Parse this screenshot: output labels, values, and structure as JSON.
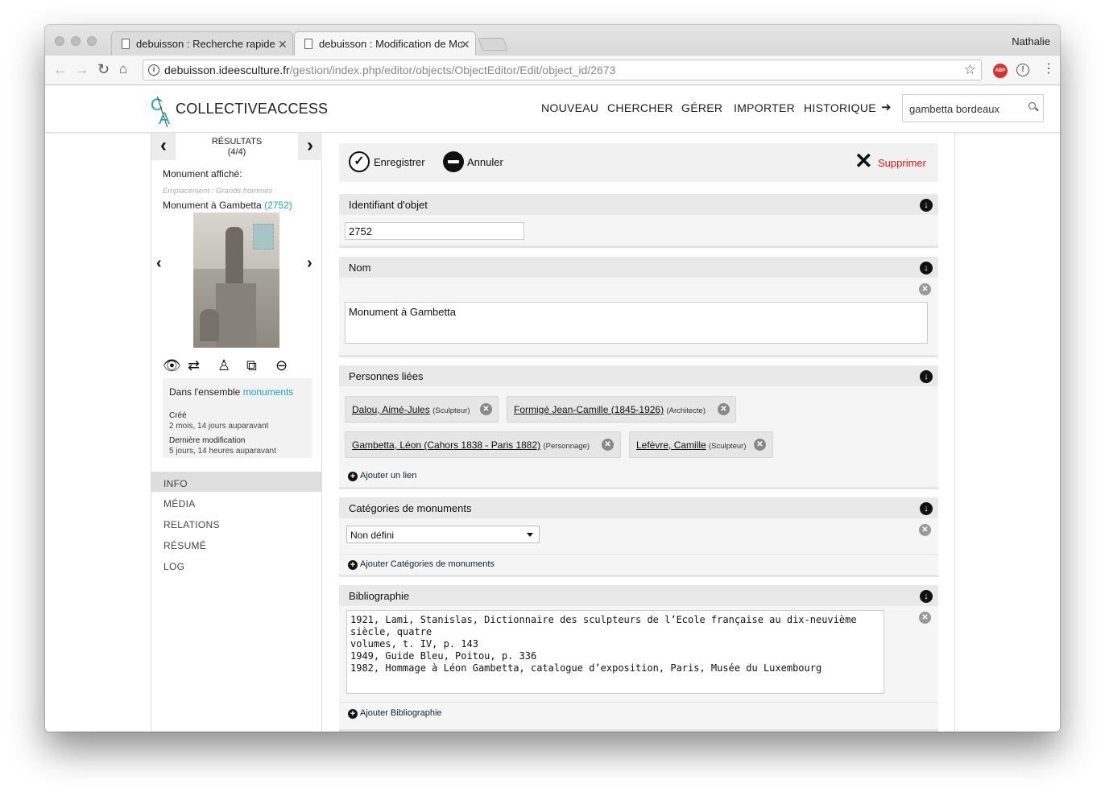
{
  "browser": {
    "tabs": [
      {
        "title": "debuisson : Recherche rapide"
      },
      {
        "title": "debuisson : Modification de Mo"
      }
    ],
    "user": "Nathalie",
    "url_host": "debuisson.ideesculture.fr",
    "url_path": "/gestion/index.php/editor/objects/ObjectEditor/Edit/object_id/2673",
    "ext_label": "ABP"
  },
  "app": {
    "logo_text": "COLLECTIVEACCESS",
    "logo_c": "C",
    "logo_a": "A",
    "nav": [
      "NOUVEAU",
      "CHERCHER",
      "GÉRER",
      "IMPORTER",
      "HISTORIQUE"
    ],
    "search_value": "gambetta bordeaux"
  },
  "sidebar": {
    "results_label": "RÉSULTATS",
    "results_count": "(4/4)",
    "shown_label": "Monument affiché:",
    "location": "Emplacement : Grands hommes",
    "object_title": "Monument à Gambetta",
    "object_id": "(2752)",
    "set_prefix": "Dans l'ensemble",
    "set_link": "monuments",
    "created_label": "Créé",
    "created_value": "2 mois, 14 jours auparavant",
    "modified_label": "Dernière modification",
    "modified_value": "5 jours, 14 heures auparavant",
    "nav": [
      "INFO",
      "MÉDIA",
      "RELATIONS",
      "RÉSUMÉ",
      "LOG"
    ]
  },
  "toolbar": {
    "save": "Enregistrer",
    "cancel": "Annuler",
    "delete": "Supprimer"
  },
  "panels": {
    "identifier": {
      "title": "Identifiant d'objet",
      "value": "2752"
    },
    "name": {
      "title": "Nom",
      "value": "Monument à Gambetta"
    },
    "persons": {
      "title": "Personnes liées",
      "chips": [
        {
          "name": "Dalou, Aimé-Jules",
          "role": "(Sculpteur)"
        },
        {
          "name": "Formigé Jean-Camille (1845-1926)",
          "role": "(Architecte)"
        },
        {
          "name": "Gambetta, Léon (Cahors 1838 - Paris 1882)",
          "role": "(Personnage)"
        },
        {
          "name": "Lefèvre, Camille",
          "role": "(Sculpteur)"
        }
      ],
      "add_label": "Ajouter un lien"
    },
    "categories": {
      "title": "Catégories de monuments",
      "selected": "Non défini",
      "add_label": "Ajouter Catégories de monuments"
    },
    "bibliography": {
      "title": "Bibliographie",
      "text": "1921, Lami, Stanislas, Dictionnaire des sculpteurs de l’Ecole française au dix-neuvième siècle, quatre\nvolumes, t. IV, p. 143\n1949, Guide Bleu, Poitou, p. 336\n1982, Hommage à Léon Gambetta, catalogue d’exposition, Paris, Musée du Luxembourg",
      "add_label": "Ajouter Bibliographie"
    }
  }
}
